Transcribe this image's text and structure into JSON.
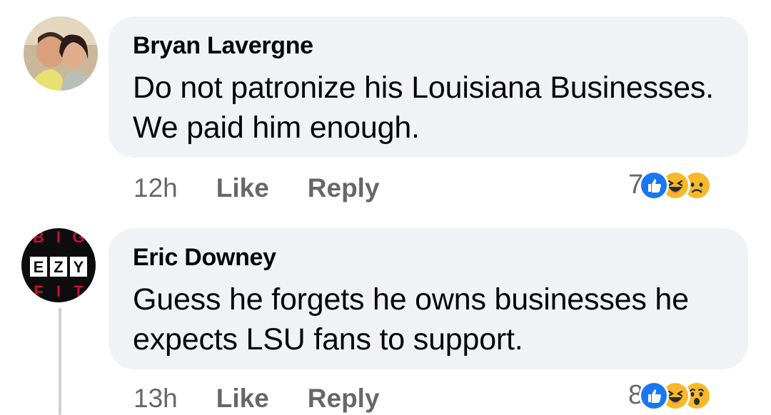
{
  "comments": [
    {
      "author": "Bryan Lavergne",
      "text": "Do not patronize his Louisiana Businesses. We paid him enough.",
      "time": "12h",
      "like_label": "Like",
      "reply_label": "Reply",
      "reaction_count": "7",
      "reactions": [
        "like-icon",
        "haha-icon",
        "sad-icon"
      ]
    },
    {
      "author": "Eric Downey",
      "text": "Guess he forgets he owns businesses he expects LSU fans to support.",
      "time": "13h",
      "like_label": "Like",
      "reply_label": "Reply",
      "reaction_count": "8",
      "reactions": [
        "like-icon",
        "haha-icon",
        "wow-icon"
      ]
    }
  ],
  "avatar2_logo_text": [
    "B",
    "I",
    "G",
    "E",
    "Z",
    "Y",
    "F",
    "I",
    "T"
  ],
  "colors": {
    "bubble": "#f0f2f5",
    "secondary_text": "#65676b",
    "like_blue": "#1877f2",
    "emoji_yellow": "#f7b928"
  }
}
